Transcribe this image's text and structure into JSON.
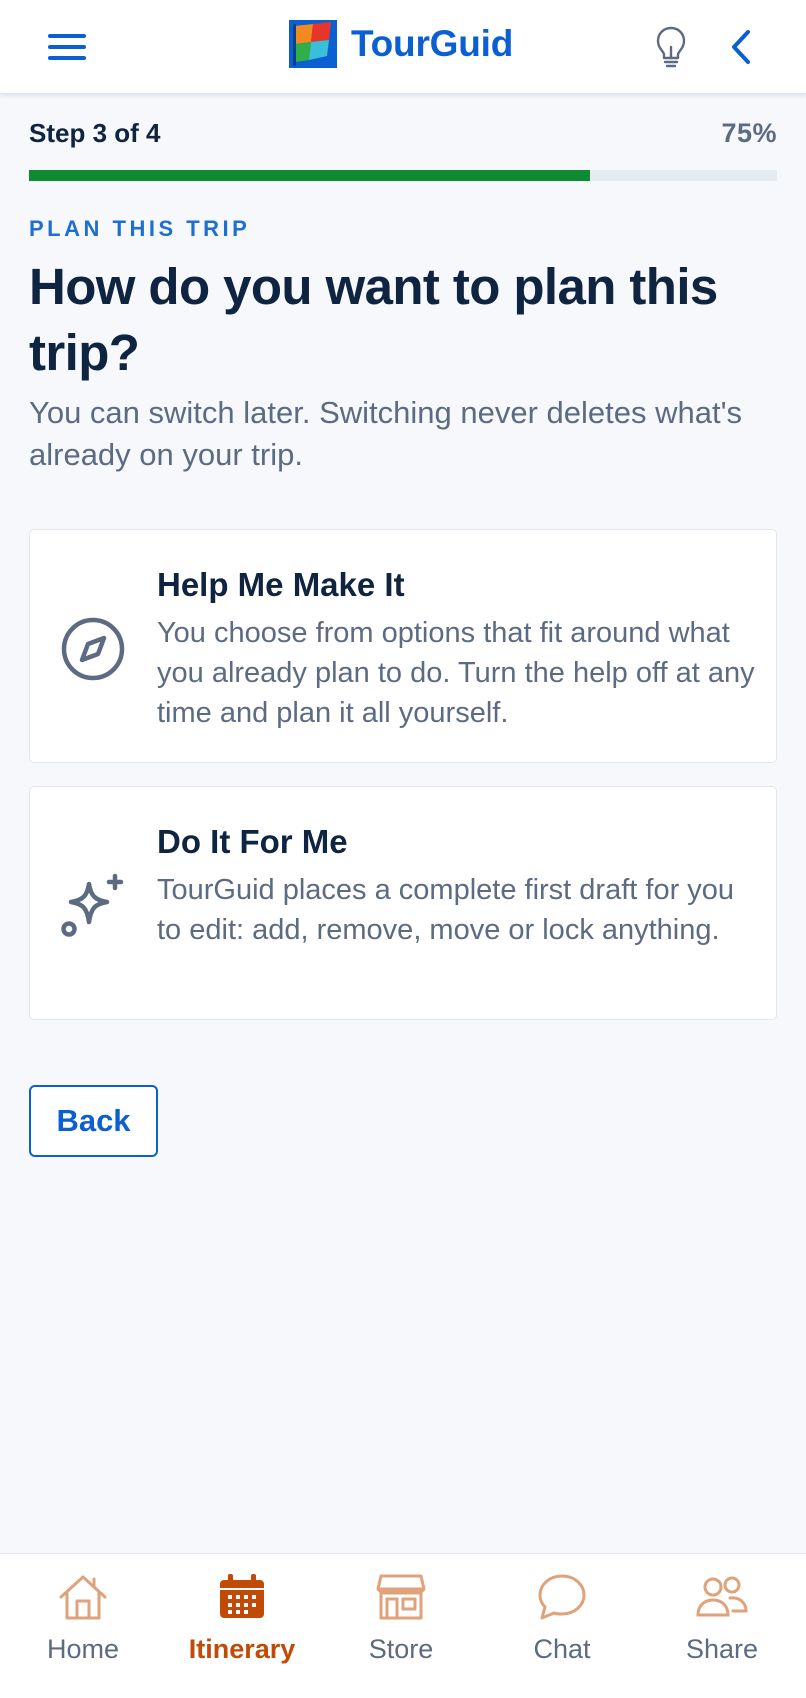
{
  "header": {
    "brand": "TourGuid",
    "icons": [
      "menu-icon",
      "brand-flag-logo",
      "lightbulb-icon",
      "chevron-left-icon"
    ]
  },
  "progress": {
    "step_text": "Step 3 of 4",
    "percent_text": "75%",
    "value": 0.75,
    "color": "#0e8a33"
  },
  "content": {
    "eyebrow": "PLAN THIS TRIP",
    "title": "How do you want to plan this trip?",
    "subtitle": "You can switch later. Switching never deletes what's already on your trip."
  },
  "options": [
    {
      "title": "Help Me Make It",
      "description": "You choose from options that fit around what you already plan to do. Turn the help off at any time and plan it all yourself.",
      "icon": "compass-icon"
    },
    {
      "title": "Do It For Me",
      "description": "TourGuid places a complete first draft for you to edit: add, remove, move or lock anything.",
      "icon": "sparkle-icon"
    }
  ],
  "back_button": "Back",
  "tabs": [
    {
      "label": "Home",
      "icon": "home-icon",
      "active": false
    },
    {
      "label": "Itinerary",
      "icon": "calendar-icon",
      "active": true
    },
    {
      "label": "Store",
      "icon": "store-icon",
      "active": false
    },
    {
      "label": "Chat",
      "icon": "chat-bubble-icon",
      "active": false
    },
    {
      "label": "Share",
      "icon": "people-icon",
      "active": false
    }
  ],
  "colors": {
    "accent": "#0b5fd0",
    "active_tab": "#c14a06",
    "inactive_tab_icon": "#e0a27a",
    "muted_text": "#5d6b82"
  }
}
